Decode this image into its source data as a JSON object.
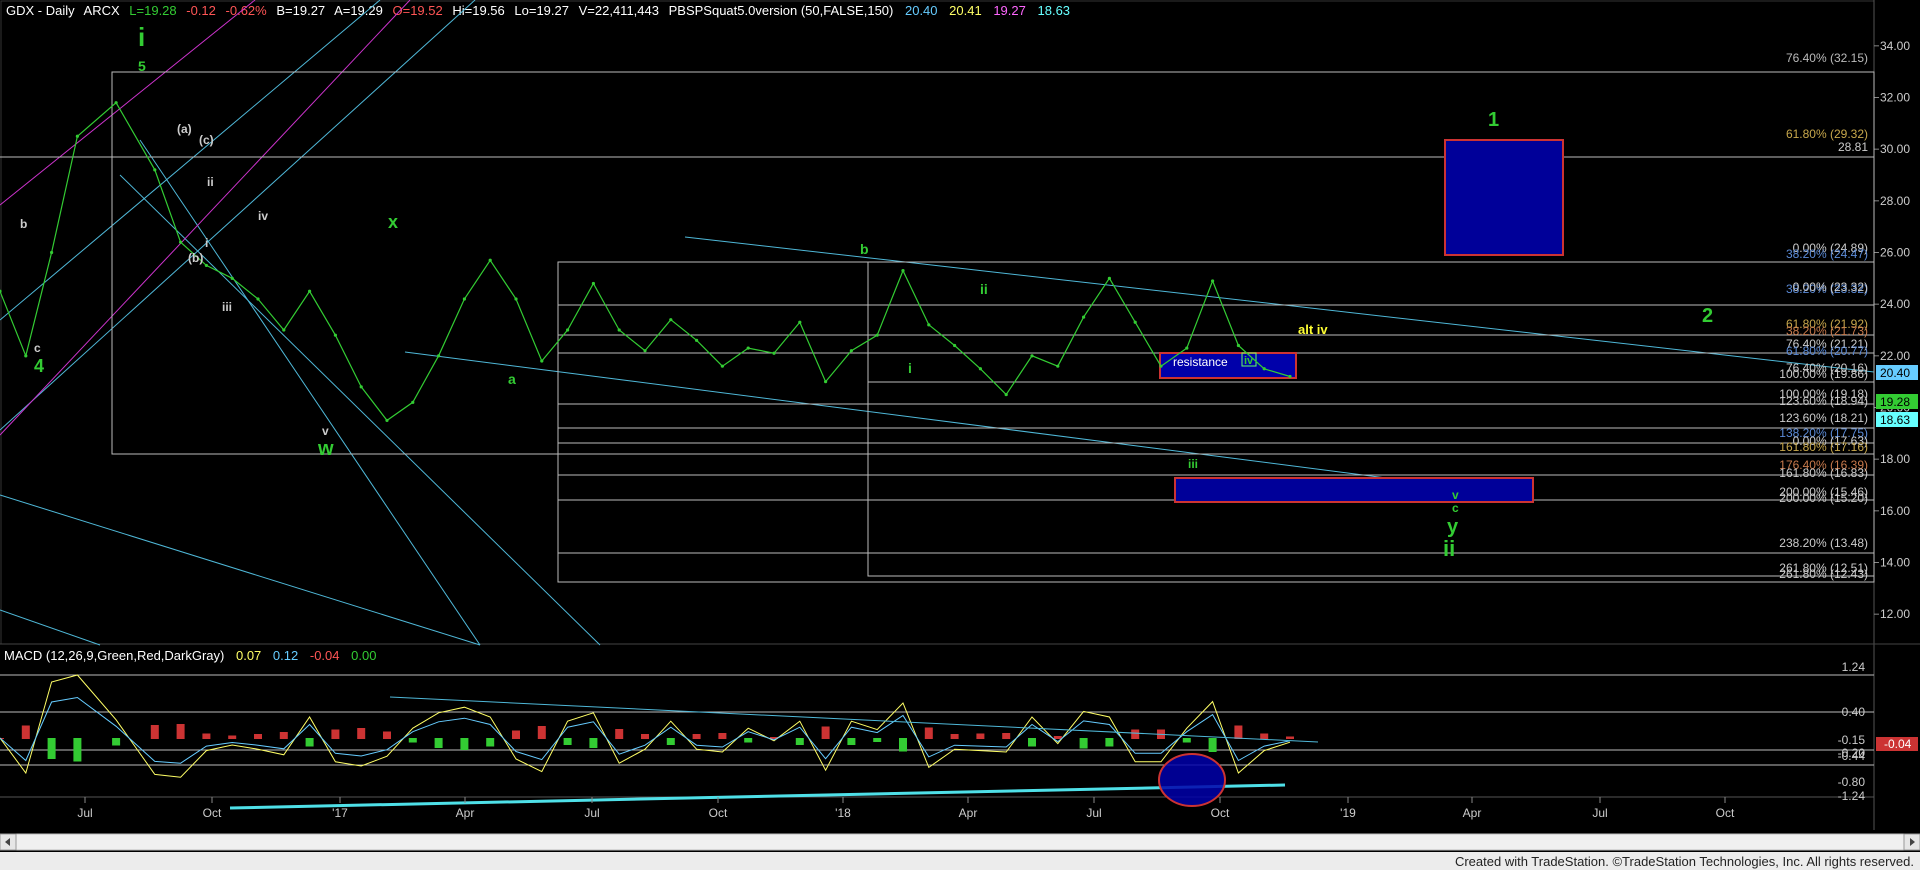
{
  "header": {
    "symbol": "GDX - Daily",
    "exchange": "ARCX",
    "last": "L=19.28",
    "change": "-0.12",
    "change_pct": "-0.62%",
    "bid": "B=19.27",
    "ask": "A=19.29",
    "open": "O=19.52",
    "high": "Hi=19.56",
    "low": "Lo=19.27",
    "volume": "V=22,411,443",
    "indicator": "PBSPSquat5.0version (50,FALSE,150)",
    "ind_values": [
      "20.40",
      "20.41",
      "19.27",
      "18.63"
    ],
    "ind_colors": [
      "#66ccff",
      "#ffff66",
      "#ff66ff",
      "#66ffff"
    ]
  },
  "macd_header": {
    "name": "MACD (12,26,9,Green,Red,DarkGray)",
    "values": [
      "0.07",
      "0.12",
      "-0.04",
      "0.00"
    ],
    "colors": [
      "#ffff66",
      "#66ccff",
      "#ff5555",
      "#33cc33"
    ]
  },
  "chart_data": {
    "type": "line",
    "title": "GDX - Daily",
    "price_axis": {
      "min": 11,
      "max": 35,
      "ticks": [
        "12.00",
        "14.00",
        "16.00",
        "18.00",
        "20.00",
        "22.00",
        "24.00",
        "26.00",
        "28.00",
        "30.00",
        "32.00",
        "34.00"
      ]
    },
    "time_axis": {
      "labels": [
        "Jul",
        "Oct",
        "'17",
        "Apr",
        "Jul",
        "Oct",
        "'18",
        "Apr",
        "Jul",
        "Oct",
        "'19",
        "Apr",
        "Jul",
        "Oct"
      ]
    },
    "series": [
      {
        "name": "GDX",
        "color": "#33cc33",
        "x": [
          0,
          0.02,
          0.04,
          0.06,
          0.09,
          0.12,
          0.14,
          0.16,
          0.18,
          0.2,
          0.22,
          0.24,
          0.26,
          0.28,
          0.3,
          0.32,
          0.34,
          0.36,
          0.38,
          0.4,
          0.42,
          0.44,
          0.46,
          0.48,
          0.5,
          0.52,
          0.54,
          0.56,
          0.58,
          0.6,
          0.62,
          0.64,
          0.66,
          0.68,
          0.7,
          0.72,
          0.74,
          0.76,
          0.78,
          0.8,
          0.82,
          0.84,
          0.86,
          0.88,
          0.9,
          0.92,
          0.94,
          0.96,
          0.98,
          1.0
        ],
        "y": [
          24.5,
          22.0,
          26.0,
          30.5,
          31.8,
          29.2,
          26.4,
          25.5,
          25.0,
          24.2,
          23.0,
          24.5,
          22.8,
          20.8,
          19.5,
          20.2,
          22.0,
          24.2,
          25.7,
          24.2,
          21.8,
          23.0,
          24.8,
          23.0,
          22.2,
          23.4,
          22.6,
          21.6,
          22.3,
          22.1,
          23.3,
          21.0,
          22.2,
          22.8,
          25.3,
          23.2,
          22.4,
          21.5,
          20.5,
          22.0,
          21.6,
          23.5,
          25.0,
          23.3,
          21.6,
          22.3,
          24.9,
          22.4,
          21.5,
          21.2
        ]
      }
    ],
    "annotations": {
      "resistance_label": "resistance",
      "price_tags": [
        "20.40",
        "19.28",
        "18.63"
      ],
      "fib_labels": [
        "76.40% (32.15)",
        "61.80% (29.32)",
        "28.81",
        "0.00% (24.89)",
        "38.20% (24.47)",
        "38.20% (23.32)",
        "0.00% (23.32)",
        "61.80% (21.92)",
        "38.20% (21.73)",
        "76.40% (21.21)",
        "61.80% (20.77)",
        "76.40% (20.16)",
        "100.00% (19.86)",
        "100.00% (19.18)",
        "123.60% (18.94)",
        "123.60% (18.21)",
        "138.20% (17.75)",
        "0.00% (17.63)",
        "161.80% (17.16)",
        "176.40% (16.39)",
        "161.80% (16.83)",
        "200.00% (15.46)",
        "200.00% (15.20)",
        "238.20% (13.48)",
        "261.80% (12.51)",
        "261.80% (12.43)"
      ],
      "wave_labels": [
        "i",
        "5",
        "4",
        "c",
        "b",
        "(a)",
        "(c)",
        "(b)",
        "ii",
        "i",
        "iii",
        "iv",
        "v",
        "w",
        "x",
        "a",
        "b",
        "i",
        "ii",
        "iii",
        "iv",
        "alt iv",
        "v",
        "c",
        "y",
        "ii",
        "1",
        "2"
      ]
    }
  },
  "macd_chart": {
    "ticks": [
      "1.24",
      "0.40",
      "-0.15",
      "-0.20",
      "-0.44",
      "-0.80",
      "-1.24"
    ],
    "tag_value": "-0.04"
  },
  "footer": {
    "credit": "Created with TradeStation. ©TradeStation Technologies, Inc. All rights reserved."
  }
}
